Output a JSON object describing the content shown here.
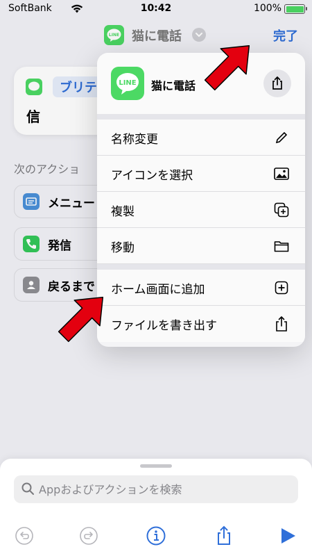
{
  "status_bar": {
    "carrier": "SoftBank",
    "time": "10:42",
    "battery_percent": "100%",
    "battery_level": 1.0
  },
  "nav": {
    "shortcut_title": "猫に電話",
    "done_label": "完了",
    "app_icon": "line-app-icon"
  },
  "editor": {
    "card_tag": "ブリテ",
    "card_line2": "信",
    "next_actions_label": "次のアクショ",
    "suggestions": [
      {
        "label": "メニュー",
        "icon": "menu-icon",
        "color": "#4a90d9"
      },
      {
        "label": "発信",
        "icon": "phone-icon",
        "color": "#34c759"
      },
      {
        "label": "戻るまで",
        "icon": "contacts-icon",
        "color": "#8e8e93"
      }
    ]
  },
  "menu": {
    "header_name": "猫に電話",
    "items": [
      {
        "label": "名称変更",
        "icon": "pencil-icon"
      },
      {
        "label": "アイコンを選択",
        "icon": "image-icon"
      },
      {
        "label": "複製",
        "icon": "duplicate-icon"
      },
      {
        "label": "移動",
        "icon": "folder-icon"
      },
      {
        "label": "ホーム画面に追加",
        "icon": "add-square-icon"
      },
      {
        "label": "ファイルを書き出す",
        "icon": "export-icon"
      }
    ]
  },
  "bottom": {
    "search_placeholder": "Appおよびアクションを検索",
    "accent": "#2f6fd9"
  },
  "icon_text": {
    "line": "LINE"
  }
}
